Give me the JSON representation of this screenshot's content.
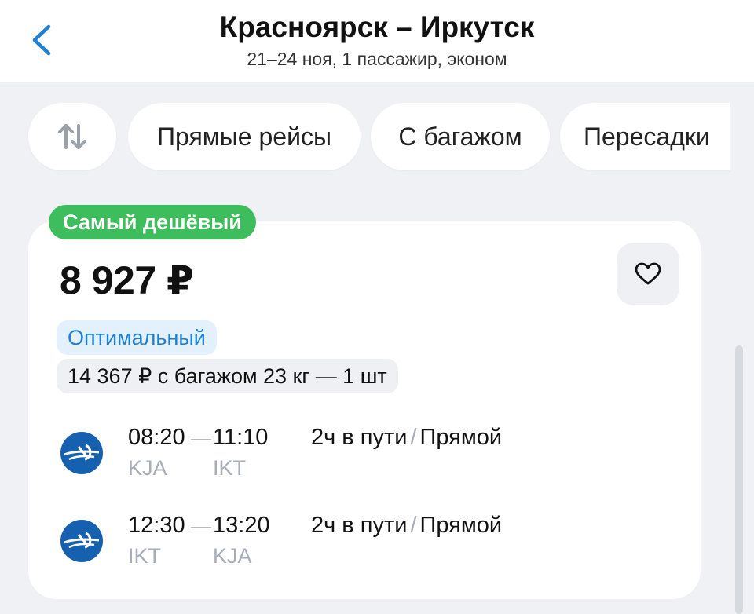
{
  "header": {
    "title": "Красноярск – Иркутск",
    "subtitle": "21–24 ноя, 1 пассажир, эконом",
    "back_icon": "chevron-left-icon"
  },
  "filters": {
    "sort_icon": "sort-arrows-icon",
    "chips": [
      "Прямые рейсы",
      "С багажом",
      "Пересадки"
    ]
  },
  "ticket": {
    "badge": "Самый дешёвый",
    "price": "8 927 ₽",
    "favorite_icon": "heart-icon",
    "tag_optimal": "Оптимальный",
    "baggage_offer": "14 367 ₽ с багажом 23 кг — 1 шт",
    "segments": [
      {
        "airline_icon": "aeroflot-logo-icon",
        "dep_time": "08:20",
        "arr_time": "11:10",
        "dep_code": "KJA",
        "arr_code": "IKT",
        "duration": "2ч в пути",
        "sep": "/",
        "type": "Прямой"
      },
      {
        "airline_icon": "aeroflot-logo-icon",
        "dep_time": "12:30",
        "arr_time": "13:20",
        "dep_code": "IKT",
        "arr_code": "KJA",
        "duration": "2ч в пути",
        "sep": "/",
        "type": "Прямой"
      }
    ]
  },
  "colors": {
    "badge_green": "#3dbd5b",
    "accent_blue": "#1e7fd4",
    "aeroflot_blue": "#1660b0"
  }
}
